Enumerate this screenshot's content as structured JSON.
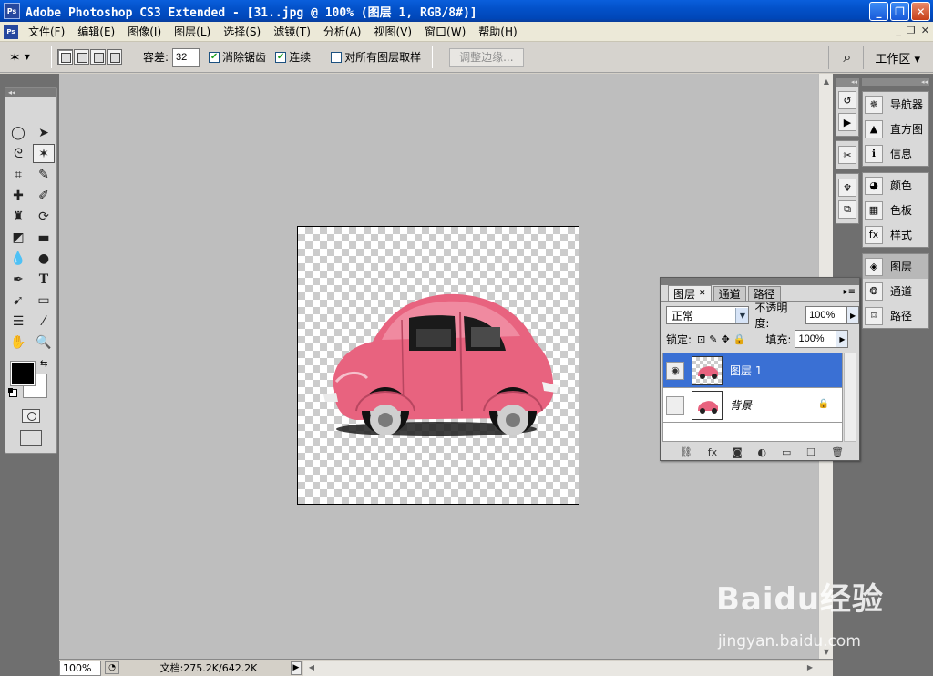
{
  "window": {
    "title": "Adobe Photoshop CS3 Extended - [31..jpg @ 100% (图层 1, RGB/8#)]",
    "app_icon": "Ps",
    "controls": [
      "_",
      "❐",
      "✕"
    ]
  },
  "menu": {
    "items": [
      "文件(F)",
      "编辑(E)",
      "图像(I)",
      "图层(L)",
      "选择(S)",
      "滤镜(T)",
      "分析(A)",
      "视图(V)",
      "窗口(W)",
      "帮助(H)"
    ],
    "doc_controls": [
      "_",
      "❐",
      "✕"
    ]
  },
  "options": {
    "tolerance_label": "容差:",
    "tolerance_value": "32",
    "anti_alias_label": "消除锯齿",
    "anti_alias_checked": true,
    "contiguous_label": "连续",
    "contiguous_checked": true,
    "sample_all_label": "对所有图层取样",
    "sample_all_checked": false,
    "refine_edge_label": "调整边缘...",
    "workspace_label": "工作区 ▾"
  },
  "status": {
    "zoom": "100%",
    "doc_size": "文档:275.2K/642.2K"
  },
  "layers_panel": {
    "tabs": [
      "图层",
      "通道",
      "路径"
    ],
    "blend_mode": "正常",
    "opacity_label": "不透明度:",
    "opacity_value": "100%",
    "lock_label": "锁定:",
    "fill_label": "填充:",
    "fill_value": "100%",
    "layers": [
      {
        "name": "图层 1",
        "selected": true,
        "visible": true
      },
      {
        "name": "背景",
        "selected": false,
        "visible": false,
        "locked": true
      }
    ]
  },
  "right_dock": {
    "groups": [
      [
        "导航器",
        "直方图",
        "信息"
      ],
      [
        "颜色",
        "色板",
        "样式"
      ],
      [
        "图层",
        "通道",
        "路径"
      ]
    ],
    "selected": "图层"
  },
  "watermark": {
    "logo": "Baidu经验",
    "url": "jingyan.baidu.com"
  },
  "colors": {
    "foreground": "#000000",
    "background": "#ffffff",
    "car_body": "#e8637f",
    "selection": "#3a70d4"
  }
}
